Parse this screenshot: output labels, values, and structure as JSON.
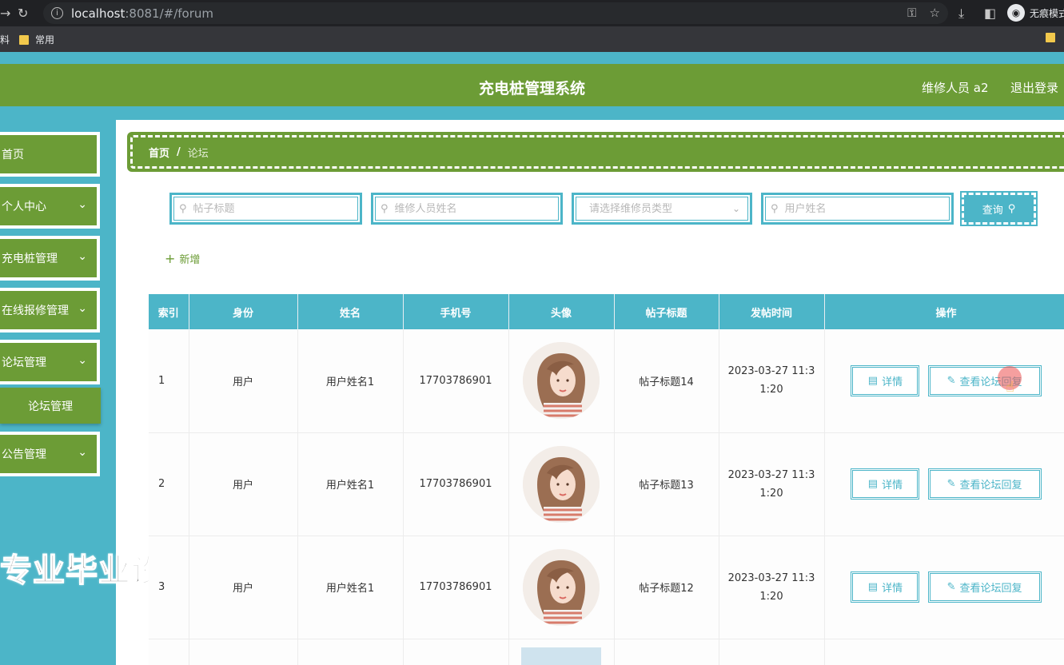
{
  "browser": {
    "url_host": "localhost",
    "url_path": ":8081/#/forum",
    "profile_label": "无痕模式",
    "bookmark_left": "料",
    "bookmark_common": "常用"
  },
  "header": {
    "title": "充电桩管理系统",
    "user": "维修人员 a2",
    "logout": "退出登录"
  },
  "sidebar": {
    "items": [
      {
        "label": "首页",
        "has_chevron": false
      },
      {
        "label": "个人中心",
        "has_chevron": true
      },
      {
        "label": "充电桩管理",
        "has_chevron": true
      },
      {
        "label": "在线报修管理",
        "has_chevron": true
      },
      {
        "label": "论坛管理",
        "has_chevron": true
      },
      {
        "label": "公告管理",
        "has_chevron": true
      }
    ],
    "active_sub": "论坛管理"
  },
  "watermark": "专业毕业设计代做",
  "breadcrumb": {
    "home": "首页",
    "separator": "/",
    "current": "论坛"
  },
  "search": {
    "post_title_placeholder": "帖子标题",
    "repair_name_placeholder": "维修人员姓名",
    "type_placeholder": "请选择维修员类型",
    "user_name_placeholder": "用户姓名",
    "query_label": "查询"
  },
  "actions": {
    "add_label": "新增"
  },
  "table": {
    "columns": [
      "索引",
      "身份",
      "姓名",
      "手机号",
      "头像",
      "帖子标题",
      "发帖时间",
      "操作"
    ],
    "rows": [
      {
        "index": "1",
        "role": "用户",
        "name": "用户姓名1",
        "phone": "17703786901",
        "title": "帖子标题14",
        "time_line1": "2023-03-27 11:3",
        "time_line2": "1:20"
      },
      {
        "index": "2",
        "role": "用户",
        "name": "用户姓名1",
        "phone": "17703786901",
        "title": "帖子标题13",
        "time_line1": "2023-03-27 11:3",
        "time_line2": "1:20"
      },
      {
        "index": "3",
        "role": "用户",
        "name": "用户姓名1",
        "phone": "17703786901",
        "title": "帖子标题12",
        "time_line1": "2023-03-27 11:3",
        "time_line2": "1:20"
      }
    ],
    "detail_label": "详情",
    "reply_label": "查看论坛回复"
  },
  "colors": {
    "primary_green": "#6c9c36",
    "accent_teal": "#4cb5c8"
  }
}
